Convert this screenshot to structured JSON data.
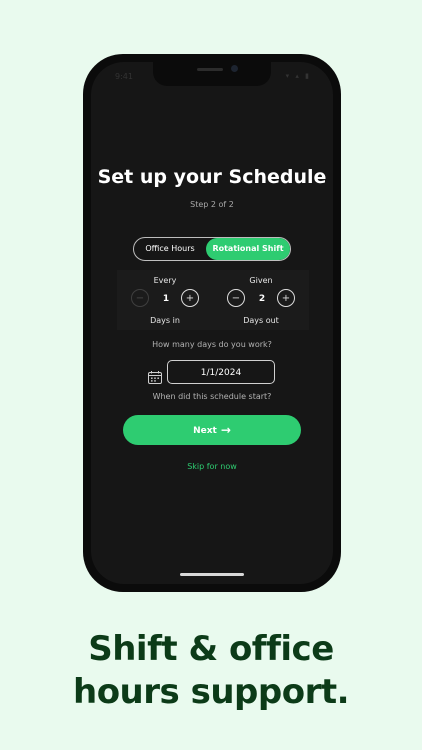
{
  "status_bar": {
    "time": "9:41",
    "icons": "▾ ▴ ▮"
  },
  "screen": {
    "title": "Set up your Schedule",
    "step": "Step 2 of 2",
    "segments": {
      "office_hours": "Office Hours",
      "rotational_shift": "Rotational Shift",
      "selected": "Rotational Shift"
    },
    "every": {
      "top_label": "Every",
      "value": "1",
      "bottom_label": "Days in",
      "minus": "−",
      "plus": "+"
    },
    "given": {
      "top_label": "Given",
      "value": "2",
      "bottom_label": "Days out",
      "minus": "−",
      "plus": "+"
    },
    "question": "How many days do you work?",
    "date_value": "1/1/2024",
    "date_caption": "When did this schedule start?",
    "next_label": "Next",
    "skip_label": "Skip for now"
  },
  "colors": {
    "accent": "#2ecc71",
    "page_bg": "#e9faee",
    "headline": "#0c3b18",
    "screen_bg": "#161616"
  },
  "icons": [
    "calendar-icon",
    "arrow-right-icon",
    "plus-icon",
    "minus-icon"
  ],
  "headline": {
    "line1": "Shift & office",
    "line2": "hours support."
  }
}
